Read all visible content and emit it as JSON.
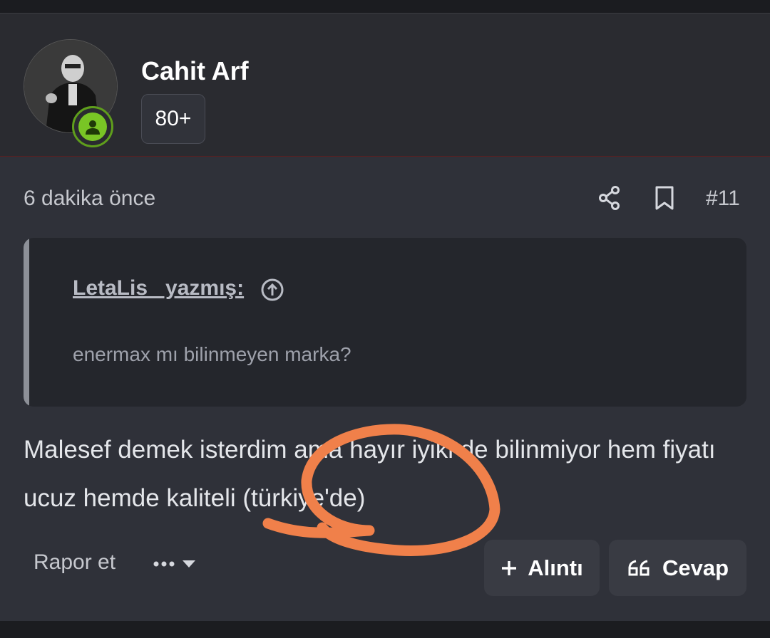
{
  "user": {
    "name": "Cahit Arf",
    "badge": "80+"
  },
  "post": {
    "time_ago": "6 dakika önce",
    "number": "#11",
    "quote": {
      "author_label": "LetaLis_ yazmış:",
      "text": "enermax mı bilinmeyen marka?"
    },
    "message": "Malesef demek isterdim ama hayır iyiki de bilinmiyor hem fiyatı ucuz hemde kaliteli (türkiye'de)"
  },
  "actions": {
    "report": "Rapor et",
    "quote_button": "Alıntı",
    "reply_button": "Cevap"
  },
  "colors": {
    "background": "#2f3139",
    "header": "#2a2b30",
    "online": "#79c525",
    "annotation": "#f0804a"
  },
  "icons": [
    "user-icon",
    "share-icon",
    "bookmark-icon",
    "arrow-up-circle-icon",
    "ellipsis-icon",
    "chevron-down-icon",
    "plus-icon",
    "quote-marks-icon"
  ]
}
